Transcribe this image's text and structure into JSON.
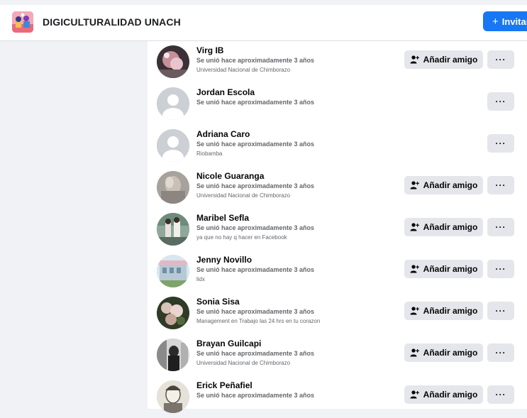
{
  "header": {
    "group_name": "DIGICULTURALIDAD UNACH",
    "invite_label": "Invitar",
    "invite_icon": "+"
  },
  "colors": {
    "primary": "#1877f2",
    "button_bg": "#e4e6eb",
    "secondary_text": "#65676b",
    "page_bg": "#f0f2f5"
  },
  "members": [
    {
      "name": "Virg IB",
      "joined": "Se unió hace aproximadamente 3 años",
      "extra": "Universidad Nacional de Chimborazo",
      "add_label": "Añadir amigo",
      "more_label": "···",
      "avatar": "photo-pink",
      "show_add": true
    },
    {
      "name": "Jordan Escola",
      "joined": "Se unió hace aproximadamente 3 años",
      "extra": "",
      "add_label": "",
      "more_label": "···",
      "avatar": "default",
      "show_add": false
    },
    {
      "name": "Adriana Caro",
      "joined": "Se unió hace aproximadamente 3 años",
      "extra": "Riobamba",
      "add_label": "",
      "more_label": "···",
      "avatar": "default",
      "show_add": false
    },
    {
      "name": "Nicole Guaranga",
      "joined": "Se unió hace aproximadamente 3 años",
      "extra": "Universidad Nacional de Chimborazo",
      "add_label": "Añadir amigo",
      "more_label": "···",
      "avatar": "photo-grey",
      "show_add": true
    },
    {
      "name": "Maribel Sefla",
      "joined": "Se unió hace aproximadamente 3 años",
      "extra": "ya que no hay q hacer en Facebook",
      "add_label": "Añadir amigo",
      "more_label": "···",
      "avatar": "photo-street",
      "show_add": true
    },
    {
      "name": "Jenny Novillo",
      "joined": "Se unió hace aproximadamente 3 años",
      "extra": "lidx",
      "add_label": "Añadir amigo",
      "more_label": "···",
      "avatar": "photo-building",
      "show_add": true
    },
    {
      "name": "Sonia Sisa",
      "joined": "Se unió hace aproximadamente 3 años",
      "extra": "Management en Trabajo las 24 hrs en tu corazon",
      "add_label": "Añadir amigo",
      "more_label": "···",
      "avatar": "photo-flowers",
      "show_add": true
    },
    {
      "name": "Brayan Guilcapi",
      "joined": "Se unió hace aproximadamente 3 años",
      "extra": "Universidad Nacional de Chimborazo",
      "add_label": "Añadir amigo",
      "more_label": "···",
      "avatar": "photo-bw",
      "show_add": true
    },
    {
      "name": "Erick Peñafiel",
      "joined": "Se unió hace aproximadamente 3 años",
      "extra": "",
      "add_label": "Añadir amigo",
      "more_label": "···",
      "avatar": "photo-sketch",
      "show_add": true
    }
  ]
}
